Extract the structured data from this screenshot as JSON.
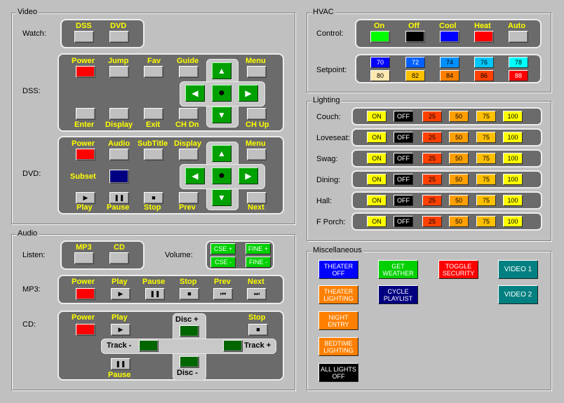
{
  "video": {
    "title": "Video",
    "watch_label": "Watch:",
    "watch_dss": "DSS",
    "watch_dvd": "DVD",
    "dss_label": "DSS:",
    "dss": {
      "power": "Power",
      "jump": "Jump",
      "fav": "Fav",
      "guide": "Guide",
      "menu": "Menu",
      "enter": "Enter",
      "display": "Display",
      "exit": "Exit",
      "chdn": "CH Dn",
      "chup": "CH Up"
    },
    "dvd_label": "DVD:",
    "dvd": {
      "power": "Power",
      "audio": "Audio",
      "subtitle": "SubTitle",
      "display": "Display",
      "menu": "Menu",
      "subset": "Subset",
      "play": "Play",
      "pause": "Pause",
      "stop": "Stop",
      "prev": "Prev",
      "next": "Next"
    }
  },
  "audio": {
    "title": "Audio",
    "listen_label": "Listen:",
    "mp3": "MP3",
    "cd": "CD",
    "volume_label": "Volume:",
    "cse_up": "CSE +",
    "fine_up": "FINE +",
    "cse_dn": "CSE -",
    "fine_dn": "FINE -",
    "mp3_label": "MP3:",
    "mp3_ctrl": {
      "power": "Power",
      "play": "Play",
      "pause": "Pause",
      "stop": "Stop",
      "prev": "Prev",
      "next": "Next"
    },
    "cd_label": "CD:",
    "cd_ctrl": {
      "power": "Power",
      "play": "Play",
      "disc_up": "Disc +",
      "stop": "Stop",
      "track_dn": "Track -",
      "track_up": "Track +",
      "pause": "Pause",
      "disc_dn": "Disc -"
    }
  },
  "hvac": {
    "title": "HVAC",
    "control_label": "Control:",
    "modes": [
      "On",
      "Off",
      "Cool",
      "Heat",
      "Auto"
    ],
    "setpoint_label": "Setpoint:",
    "setpoints_row1": [
      "70",
      "72",
      "74",
      "76",
      "78"
    ],
    "setpoints_row2": [
      "80",
      "82",
      "84",
      "86",
      "88"
    ]
  },
  "lighting": {
    "title": "Lighting",
    "rows": [
      "Couch:",
      "Loveseat:",
      "Swag:",
      "Dining:",
      "Hall:",
      "F Porch:"
    ],
    "levels": [
      "ON",
      "OFF",
      "25",
      "50",
      "75",
      "100"
    ]
  },
  "misc": {
    "title": "Miscellaneous",
    "theater_off": "THEATER OFF",
    "get_weather": "GET WEATHER",
    "toggle_security": "TOGGLE SECURITY",
    "video1": "VIDEO 1",
    "theater_lighting": "THEATER LIGHTING",
    "cycle_playlist": "CYCLE PLAYLIST",
    "video2": "VIDEO 2",
    "night_entry": "NIGHT ENTRY",
    "bedtime_lighting": "BEDTIME LIGHTING",
    "all_lights_off": "ALL LIGHTS OFF"
  },
  "colors": {
    "panel": "#6b6b6b",
    "label_yellow": "#ffff00",
    "nav_green": "#00a000",
    "level_on": "#ffff00",
    "level_off": "#000000",
    "level_25": "#ff4000",
    "level_50": "#ffa000",
    "level_75": "#ffc000",
    "level_100": "#ffff00"
  },
  "icons": [
    "play-icon",
    "pause-icon",
    "stop-icon",
    "prev-icon",
    "next-icon",
    "arrow-up-icon",
    "arrow-down-icon",
    "arrow-left-icon",
    "arrow-right-icon",
    "dot-icon"
  ]
}
